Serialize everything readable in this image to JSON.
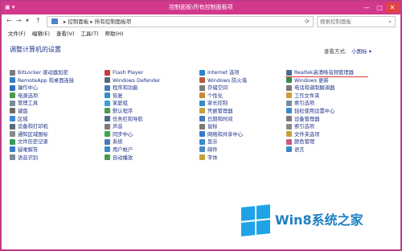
{
  "window": {
    "title": "控制面板\\所有控制面板项",
    "controls": {
      "minimize": "—",
      "maximize": "□",
      "close": "✕"
    }
  },
  "addressbar": {
    "back": "←",
    "forward": "→",
    "up": "↑",
    "crumbs": "▸ 控制面板 ▸ 所有控制面板项",
    "refresh": "⟳",
    "search_placeholder": "搜索控制面板"
  },
  "menu": [
    "文件(F)",
    "编辑(E)",
    "查看(V)",
    "工具(T)",
    "帮助(H)"
  ],
  "heading": "调整计算机的设置",
  "viewby": {
    "label": "查看方式:",
    "value": "小图标 ▾"
  },
  "columns": [
    [
      {
        "label": "BitLocker 驱动器加密",
        "color": "#7a7a7a"
      },
      {
        "label": "RemoteApp 和桌面连接",
        "color": "#3a7bc8"
      },
      {
        "label": "操作中心",
        "color": "#2d6fc0"
      },
      {
        "label": "电源选项",
        "color": "#4b9a4b"
      },
      {
        "label": "管理工具",
        "color": "#7a8a9a"
      },
      {
        "label": "键盘",
        "color": "#6b6b6b"
      },
      {
        "label": "区域",
        "color": "#3b8ad1"
      },
      {
        "label": "设备和打印机",
        "color": "#5a6b7a"
      },
      {
        "label": "通知区域图标",
        "color": "#8a8a8a"
      },
      {
        "label": "文件历史记录",
        "color": "#3a9a5a"
      },
      {
        "label": "疑难解答",
        "color": "#3a7bc8"
      },
      {
        "label": "语音识别",
        "color": "#7a8a9a"
      }
    ],
    [
      {
        "label": "Flash Player",
        "color": "#c83a3a"
      },
      {
        "label": "Windows Defender",
        "color": "#5a6b7a"
      },
      {
        "label": "程序和功能",
        "color": "#4a7ab8"
      },
      {
        "label": "恢复",
        "color": "#3a8ac8"
      },
      {
        "label": "家庭组",
        "color": "#3aa0d8"
      },
      {
        "label": "默认程序",
        "color": "#4a9a4a"
      },
      {
        "label": "任务栏和导航",
        "color": "#4a6a8a"
      },
      {
        "label": "声音",
        "color": "#7a7a7a"
      },
      {
        "label": "同步中心",
        "color": "#3aaa4a"
      },
      {
        "label": "系统",
        "color": "#4a7ab8"
      },
      {
        "label": "用户帐户",
        "color": "#3a8ac8"
      },
      {
        "label": "自动播放",
        "color": "#4a9a4a"
      }
    ],
    [
      {
        "label": "Internet 选项",
        "color": "#2d82c8"
      },
      {
        "label": "Windows 防火墙",
        "color": "#b85a3a"
      },
      {
        "label": "存储空间",
        "color": "#7a7a7a"
      },
      {
        "label": "个性化",
        "color": "#c88a3a"
      },
      {
        "label": "家长控制",
        "color": "#3a8ac8"
      },
      {
        "label": "凭据管理器",
        "color": "#c8a03a"
      },
      {
        "label": "日期和时间",
        "color": "#4a7ab8"
      },
      {
        "label": "鼠标",
        "color": "#7a7a7a"
      },
      {
        "label": "网络和共享中心",
        "color": "#3a7bc8"
      },
      {
        "label": "显示",
        "color": "#3a8ac8"
      },
      {
        "label": "邮件",
        "color": "#4a8ac8"
      },
      {
        "label": "字体",
        "color": "#c8a03a"
      }
    ],
    [
      {
        "label": "Realtek高清晰音频管理器",
        "color": "#4a6a9a"
      },
      {
        "label": "Windows 更新",
        "color": "#3a8a4a"
      },
      {
        "label": "电话和调制解调器",
        "color": "#7a7a7a"
      },
      {
        "label": "工作文件夹",
        "color": "#c8a03a"
      },
      {
        "label": "索引选项",
        "color": "#7a8a9a"
      },
      {
        "label": "轻松使用设置中心",
        "color": "#3a8ac8"
      },
      {
        "label": "设备管理器",
        "color": "#7a7a7a"
      },
      {
        "label": "索引选项",
        "color": "#8a8a8a"
      },
      {
        "label": "文件夹选项",
        "color": "#c8a03a"
      },
      {
        "label": "颜色管理",
        "color": "#c85a8a"
      },
      {
        "label": "语言",
        "color": "#3a8ac8"
      }
    ]
  ],
  "watermark": {
    "text": "Win8系统之家",
    "color": "#1c7fc3"
  }
}
